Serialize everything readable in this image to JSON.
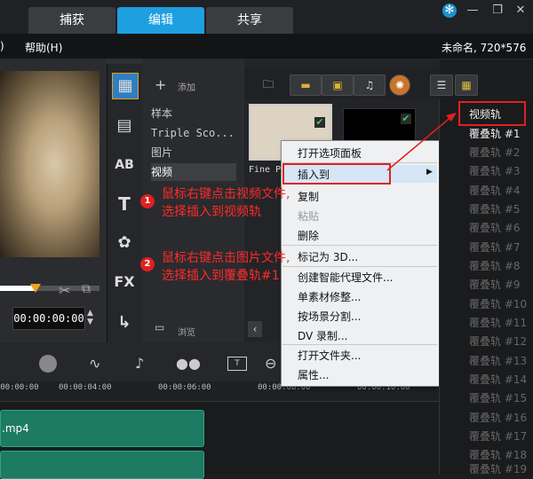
{
  "tabs": [
    {
      "label": "捕获",
      "active": false
    },
    {
      "label": "编辑",
      "active": true
    },
    {
      "label": "共享",
      "active": false
    }
  ],
  "window_buttons": {
    "settings": "✻",
    "minimize": "—",
    "restore": "❐",
    "close": "✕"
  },
  "menubar": {
    "left_partial": ")",
    "help": "帮助(H)",
    "project_info": "未命名, 720*576"
  },
  "preview": {
    "timecode": "00:00:00:00"
  },
  "library": {
    "add_label": "添加",
    "browse_label": "浏览",
    "folders": [
      "样本",
      "Triple Sco...",
      "图片",
      "视频"
    ],
    "selected_folder": "视频",
    "sidebar_icons": [
      "media-icon",
      "transition-icon",
      "title-ab-icon",
      "text-t-icon",
      "graphic-icon",
      "fx-icon",
      "path-icon"
    ],
    "sidebar_glyphs": {
      "ab": "AB",
      "t": "T",
      "fx": "FX"
    },
    "thumb_label": "Fine Pa"
  },
  "timeline": {
    "ticks": [
      "00:00:00:00",
      "00:00:04:00",
      "00:00:06:00",
      "00:00:08:00",
      "00:00:10:00"
    ],
    "clip_label": ".mp4"
  },
  "context_menu": {
    "items": [
      {
        "label": "打开选项面板",
        "enabled": true
      },
      {
        "label": "插入到",
        "enabled": true,
        "submenu": true
      },
      {
        "label": "复制",
        "enabled": true
      },
      {
        "label": "粘贴",
        "enabled": false
      },
      {
        "label": "删除",
        "enabled": true
      },
      {
        "label": "标记为 3D...",
        "enabled": true
      },
      {
        "label": "创建智能代理文件...",
        "enabled": true
      },
      {
        "label": "单素材修整...",
        "enabled": true
      },
      {
        "label": "按场景分割...",
        "enabled": true
      },
      {
        "label": "DV 录制...",
        "enabled": true
      },
      {
        "label": "打开文件夹...",
        "enabled": true
      },
      {
        "label": "属性...",
        "enabled": true
      }
    ]
  },
  "submenu": {
    "items": [
      "视频轨",
      "覆叠轨 #1",
      "覆叠轨 #2",
      "覆叠轨 #3",
      "覆叠轨 #4",
      "覆叠轨 #5",
      "覆叠轨 #6",
      "覆叠轨 #7",
      "覆叠轨 #8",
      "覆叠轨 #9",
      "覆叠轨 #10",
      "覆叠轨 #11",
      "覆叠轨 #12",
      "覆叠轨 #13",
      "覆叠轨 #14",
      "覆叠轨 #15",
      "覆叠轨 #16",
      "覆叠轨 #17",
      "覆叠轨 #18",
      "覆叠轨 #19"
    ]
  },
  "annotations": {
    "step1_badge": "1",
    "step1_line1": "鼠标右键点击视频文件,",
    "step1_line2": "选择插入到视频轨",
    "step2_badge": "2",
    "step2_line1": "鼠标右键点击图片文件,",
    "step2_line2": "选择插入到覆叠轨#1",
    "color": "#e02020"
  },
  "colors": {
    "accent_tab": "#1e9fe0",
    "clip": "#1d7a63",
    "scrub_head": "#f0a020"
  }
}
